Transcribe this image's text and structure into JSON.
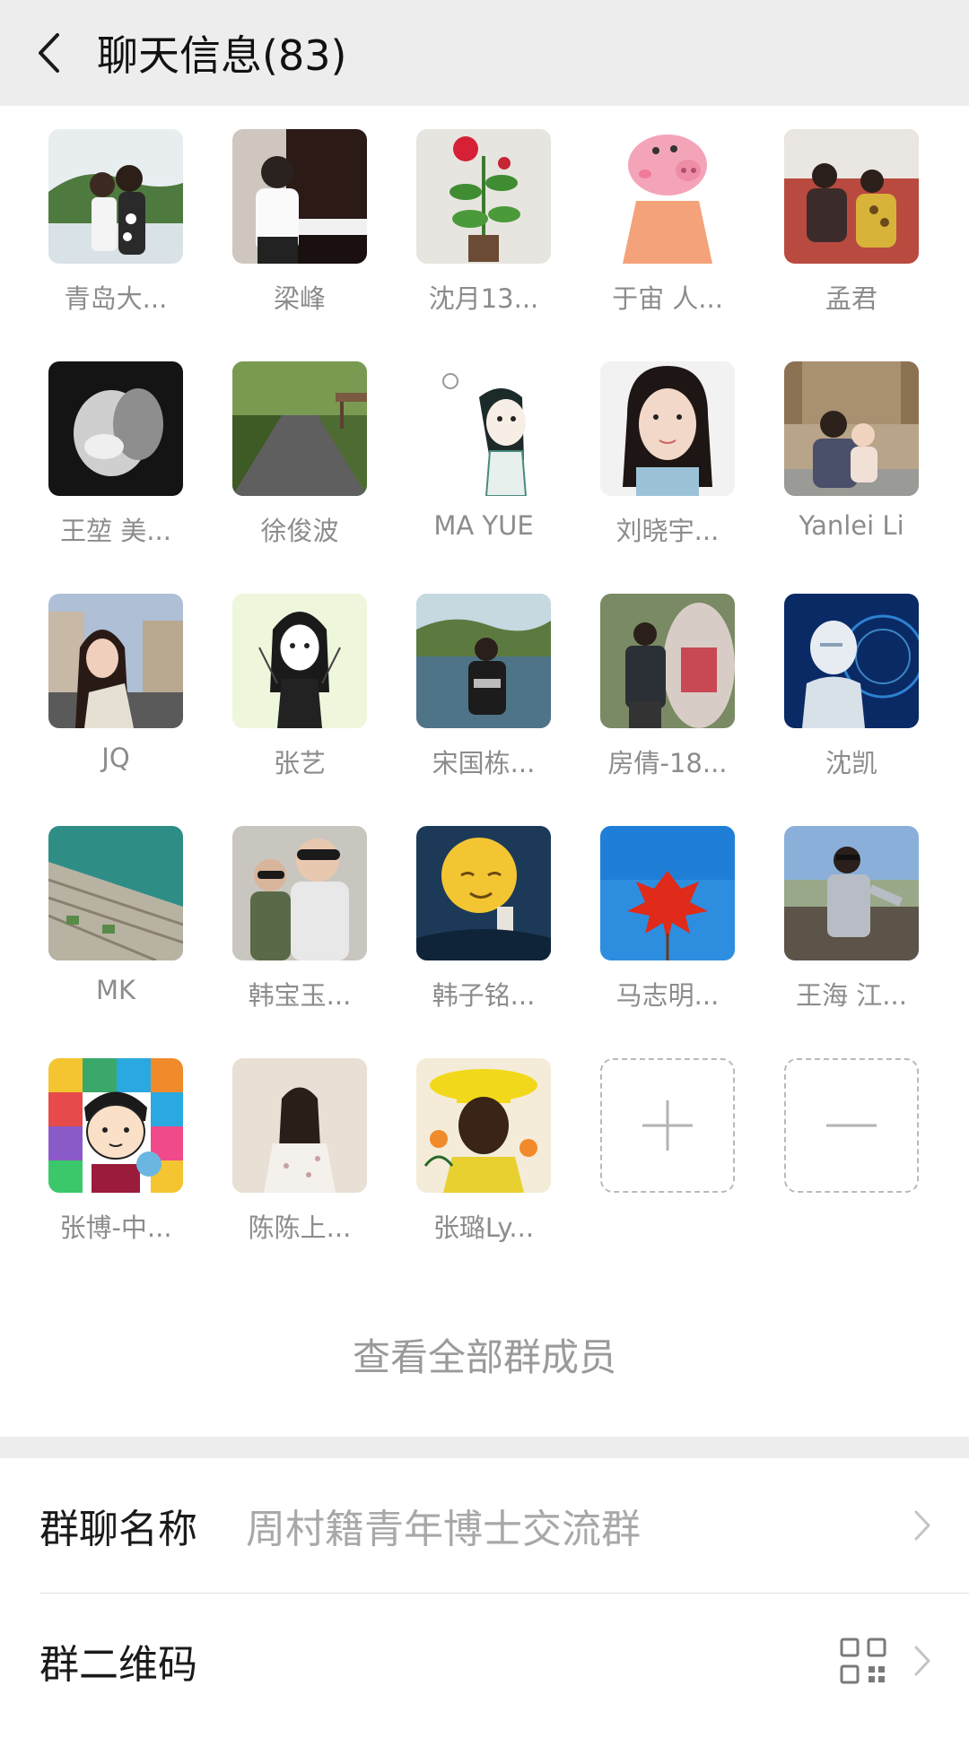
{
  "header": {
    "back_icon": "chevron-left-icon",
    "title": "聊天信息(83)"
  },
  "members": [
    {
      "name": "青岛大...",
      "avatar": "photo"
    },
    {
      "name": "梁峰",
      "avatar": "photo"
    },
    {
      "name": "沈月13...",
      "avatar": "photo"
    },
    {
      "name": "于宙 人...",
      "avatar": "cartoon"
    },
    {
      "name": "孟君",
      "avatar": "photo"
    },
    {
      "name": "王堃 美...",
      "avatar": "photo"
    },
    {
      "name": "徐俊波",
      "avatar": "photo"
    },
    {
      "name": "MA YUE",
      "avatar": "drawing"
    },
    {
      "name": "刘晓宇...",
      "avatar": "photo"
    },
    {
      "name": "Yanlei Li",
      "avatar": "photo"
    },
    {
      "name": "JQ",
      "avatar": "photo"
    },
    {
      "name": "张艺",
      "avatar": "drawing"
    },
    {
      "name": "宋国栋...",
      "avatar": "photo"
    },
    {
      "name": "房倩-18...",
      "avatar": "photo"
    },
    {
      "name": "沈凯",
      "avatar": "robot"
    },
    {
      "name": "MK",
      "avatar": "aerial"
    },
    {
      "name": "韩宝玉...",
      "avatar": "photo"
    },
    {
      "name": "韩子铭...",
      "avatar": "illustration"
    },
    {
      "name": "马志明...",
      "avatar": "leaf"
    },
    {
      "name": "王海 江...",
      "avatar": "photo"
    },
    {
      "name": "张博-中...",
      "avatar": "cartoon"
    },
    {
      "name": "陈陈上...",
      "avatar": "photo"
    },
    {
      "name": "张璐Ly...",
      "avatar": "illustration"
    }
  ],
  "add_member_icon": "plus-icon",
  "remove_member_icon": "minus-icon",
  "view_all_label": "查看全部群成员",
  "settings": {
    "group_name_label": "群聊名称",
    "group_name_value": "周村籍青年博士交流群",
    "qr_label": "群二维码",
    "qr_icon": "qr-code-icon",
    "chevron_icon": "chevron-right-icon"
  },
  "colors": {
    "header_bg": "#ededed",
    "separator": "#ededed",
    "name_text": "#8c8c8c",
    "value_text": "#a8a8a8"
  }
}
